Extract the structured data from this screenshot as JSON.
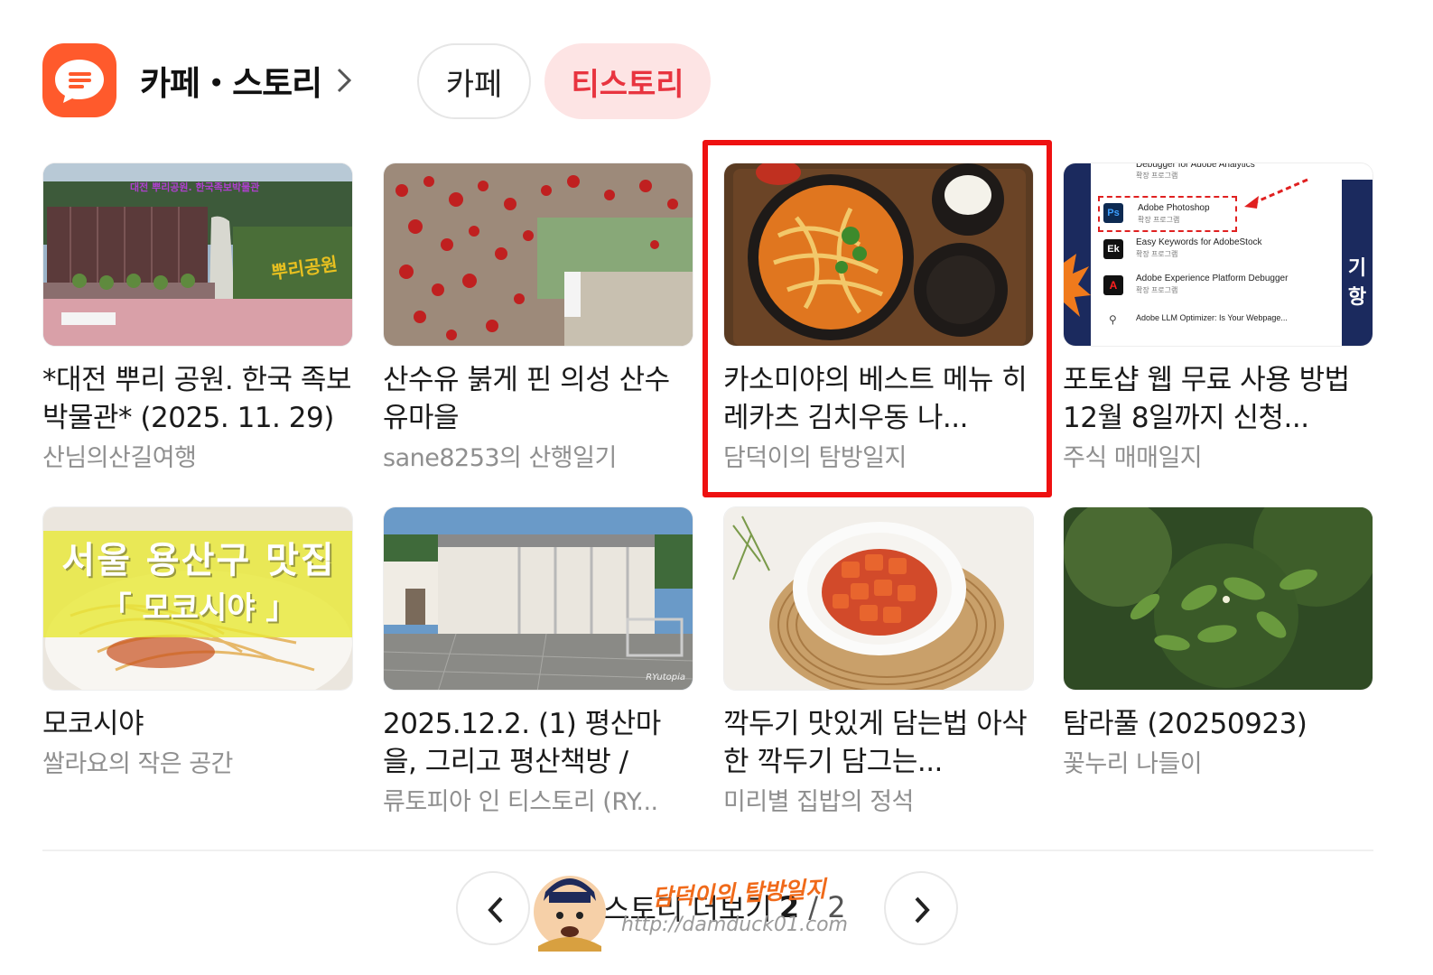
{
  "header": {
    "title": "카페・스토리",
    "tabs": [
      {
        "label": "카페",
        "active": false
      },
      {
        "label": "티스토리",
        "active": true
      }
    ],
    "accent": "#e8343f",
    "app_icon_color": "#ff5a2c"
  },
  "cards": [
    {
      "title": "*대전 뿌리 공원. 한국 족보 박물관* (2025. 11. 29)",
      "source": "산님의산길여행",
      "thumb_text": "대전 뿌리공원. 한국족보박물관",
      "thumb_sign": "뿌리공원"
    },
    {
      "title": "산수유 붉게 핀 의성 산수유마을",
      "source": "sane8253의 산행일기"
    },
    {
      "title": "카소미야의 베스트 메뉴 히레카츠 김치우동 나...",
      "source": "담덕이의 탐방일지",
      "highlighted": true
    },
    {
      "title": "포토샵 웹 무료 사용 방법 12월 8일까지 신청...",
      "source": "주식 매매일지",
      "thumb_lines": [
        {
          "name": "Debugger for Adobe Analytics",
          "sub": "확장 프로그램"
        },
        {
          "icon": "Ps",
          "name": "Adobe Photoshop",
          "sub": "확장 프로그램"
        },
        {
          "icon": "Ek",
          "name": "Easy Keywords for AdobeStock",
          "sub": "확장 프로그램"
        },
        {
          "icon": "A",
          "name": "Adobe Experience Platform Debugger",
          "sub": "확장 프로그램"
        },
        {
          "name": "Adobe LLM Optimizer: Is Your Webpage..."
        }
      ],
      "thumb_side": "기 항"
    },
    {
      "title": "모코시야",
      "source": "쌀라요의 작은 공간",
      "thumb_text_1": "서울 용산구 맛집",
      "thumb_text_2": "「 모코시야 」"
    },
    {
      "title": "2025.12.2. (1) 평산마을, 그리고 평산책방 / 202...",
      "source": "류토피아 인 티스토리 (RY...",
      "thumb_mark": "RYutopia"
    },
    {
      "title": "깍두기 맛있게 담는법 아삭한 깍두기 담그는...",
      "source": "미리별 집밥의 정석"
    },
    {
      "title": "탐라풀 (20250923)",
      "source": "꽃누리 나들이"
    }
  ],
  "footer": {
    "more_label": "스토리 더보기",
    "page_current": "2",
    "page_total": "/ 2",
    "watermark_title": "담덕이의 탐방일지",
    "watermark_url": "http://damduck01.com"
  }
}
